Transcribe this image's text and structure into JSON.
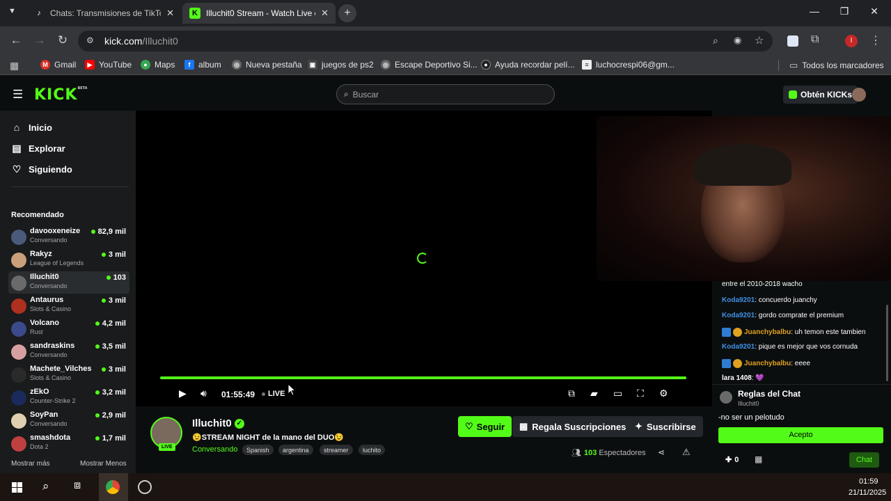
{
  "browser": {
    "tabs": [
      {
        "title": "Chats: Transmisiones de TikTok",
        "active": false
      },
      {
        "title": "Illuchit0 Stream - Watch Live on",
        "active": true
      }
    ],
    "url_host": "kick.com",
    "url_path": "/Illuchit0",
    "bookmarks": [
      "Gmail",
      "YouTube",
      "Maps",
      "album",
      "Nueva pestaña",
      "juegos de ps2",
      "Escape Deportivo Si...",
      "Ayuda recordar pelí...",
      "luchocrespi06@gm..."
    ],
    "all_bookmarks": "Todos los marcadores",
    "profile_initial": "I"
  },
  "kick": {
    "logo": "KICK",
    "logo_badge": "BETA",
    "search_placeholder": "Buscar",
    "get_kicks": "Obtén KICKs"
  },
  "sidebar": {
    "nav": [
      {
        "label": "Inicio",
        "icon": "home-icon"
      },
      {
        "label": "Explorar",
        "icon": "compass-icon"
      },
      {
        "label": "Siguiendo",
        "icon": "heart-icon"
      }
    ],
    "recommended_title": "Recomendado",
    "recommended": [
      {
        "name": "davooxeneize",
        "category": "Conversando",
        "viewers": "82,9 mil",
        "color": "#4a5a7a"
      },
      {
        "name": "Rakyz",
        "category": "League of Legends",
        "viewers": "3 mil",
        "color": "#c9a07a"
      },
      {
        "name": "Illuchit0",
        "category": "Conversando",
        "viewers": "103",
        "color": "#6a6a6a"
      },
      {
        "name": "Antaurus",
        "category": "Slots & Casino",
        "viewers": "3 mil",
        "color": "#b03020"
      },
      {
        "name": "Volcano",
        "category": "Rust",
        "viewers": "4,2 mil",
        "color": "#3a4a8a"
      },
      {
        "name": "sandraskins",
        "category": "Conversando",
        "viewers": "3,5 mil",
        "color": "#d6a0a0"
      },
      {
        "name": "Machete_Vilches",
        "category": "Slots & Casino",
        "viewers": "3 mil",
        "color": "#2a2a2a"
      },
      {
        "name": "zEkO",
        "category": "Counter-Strike 2",
        "viewers": "3,2 mil",
        "color": "#1a2a5a"
      },
      {
        "name": "SoyPan",
        "category": "Conversando",
        "viewers": "2,9 mil",
        "color": "#e0d0b0"
      },
      {
        "name": "smashdota",
        "category": "Dota 2",
        "viewers": "1,7 mil",
        "color": "#c04040"
      }
    ],
    "show_more": "Mostrar más",
    "show_less": "Mostrar Menos"
  },
  "player": {
    "time": "01:55:49",
    "live": "LIVE",
    "progress": 1.0
  },
  "stream": {
    "channel": "Illuchit0",
    "live_badge": "LIVE",
    "title": "😉STREAM NIGHT de la mano del DUO😉",
    "category": "Conversando",
    "tags": [
      "Spanish",
      "argentina",
      "streamer",
      "luchito"
    ],
    "follow": "Seguir",
    "gift": "Regala Suscripciones",
    "subscribe": "Suscribirse",
    "viewers": "103",
    "viewers_label": "Espectadores"
  },
  "chat": {
    "messages": [
      {
        "user": "",
        "text": "entre el 2010-2018 wacho",
        "color": "#ffffff",
        "badges": 0
      },
      {
        "user": "Koda9201",
        "text": ": concuerdo juanchy",
        "color": "#3f90e5",
        "badges": 0
      },
      {
        "user": "Koda9201",
        "text": ": gordo comprate el premium",
        "color": "#3f90e5",
        "badges": 0
      },
      {
        "user": "Juanchybalbu",
        "text": ": uh temon este tambien",
        "color": "#e0a020",
        "badges": 2
      },
      {
        "user": "Koda9201",
        "text": ": pique es mejor que vos cornuda",
        "color": "#3f90e5",
        "badges": 0
      },
      {
        "user": "Juanchybalbu",
        "text": ": eeee",
        "color": "#e0a020",
        "badges": 2
      },
      {
        "user": "lara 1408",
        "text": ": 💜",
        "color": "#ffffff",
        "badges": 0
      }
    ],
    "rules_title": "Reglas del Chat",
    "rules_owner": "Illuchit0",
    "rule": "-no ser un pelotudo",
    "accept": "Acepto",
    "points": "0",
    "send": "Chat"
  },
  "taskbar": {
    "time": "01:59",
    "date": "21/11/2025"
  },
  "colors": {
    "kick_green": "#53fc18"
  }
}
